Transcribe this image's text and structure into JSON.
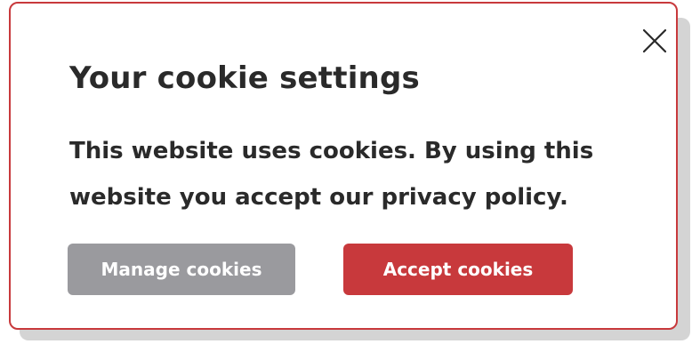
{
  "dialog": {
    "title": "Your cookie settings",
    "message": "This website uses cookies. By using this website you accept our privacy policy.",
    "close_icon": "close-icon"
  },
  "buttons": {
    "manage_label": "Manage cookies",
    "accept_label": "Accept cookies"
  },
  "colors": {
    "accent": "#c8393c",
    "secondary_button": "#9a9a9e",
    "text": "#2a2a2a",
    "shadow": "#d4d4d4"
  }
}
